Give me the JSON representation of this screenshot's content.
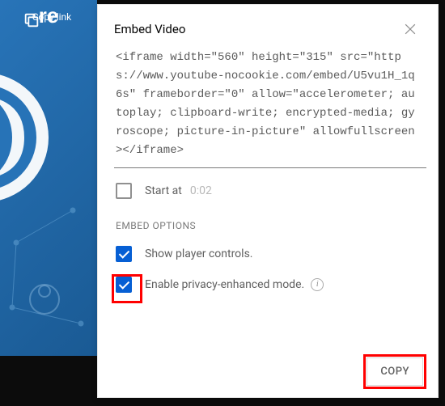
{
  "sidebar": {
    "copy_link_label": "Copy link"
  },
  "panel": {
    "title": "Embed Video",
    "embed_code": "<iframe width=\"560\" height=\"315\" src=\"https://www.youtube-nocookie.com/embed/U5vu1H_1q6s\" frameborder=\"0\" allow=\"accelerometer; autoplay; clipboard-write; encrypted-media; gyroscope; picture-in-picture\" allowfullscreen></iframe>",
    "start_at": {
      "label": "Start at",
      "time": "0:02",
      "checked": false
    },
    "options_heading": "EMBED OPTIONS",
    "options": [
      {
        "label": "Show player controls.",
        "checked": true,
        "info": false
      },
      {
        "label": "Enable privacy-enhanced mode.",
        "checked": true,
        "info": true
      }
    ],
    "copy_button": "COPY"
  },
  "colors": {
    "accent": "#065fd4",
    "highlight": "#ff0000"
  }
}
